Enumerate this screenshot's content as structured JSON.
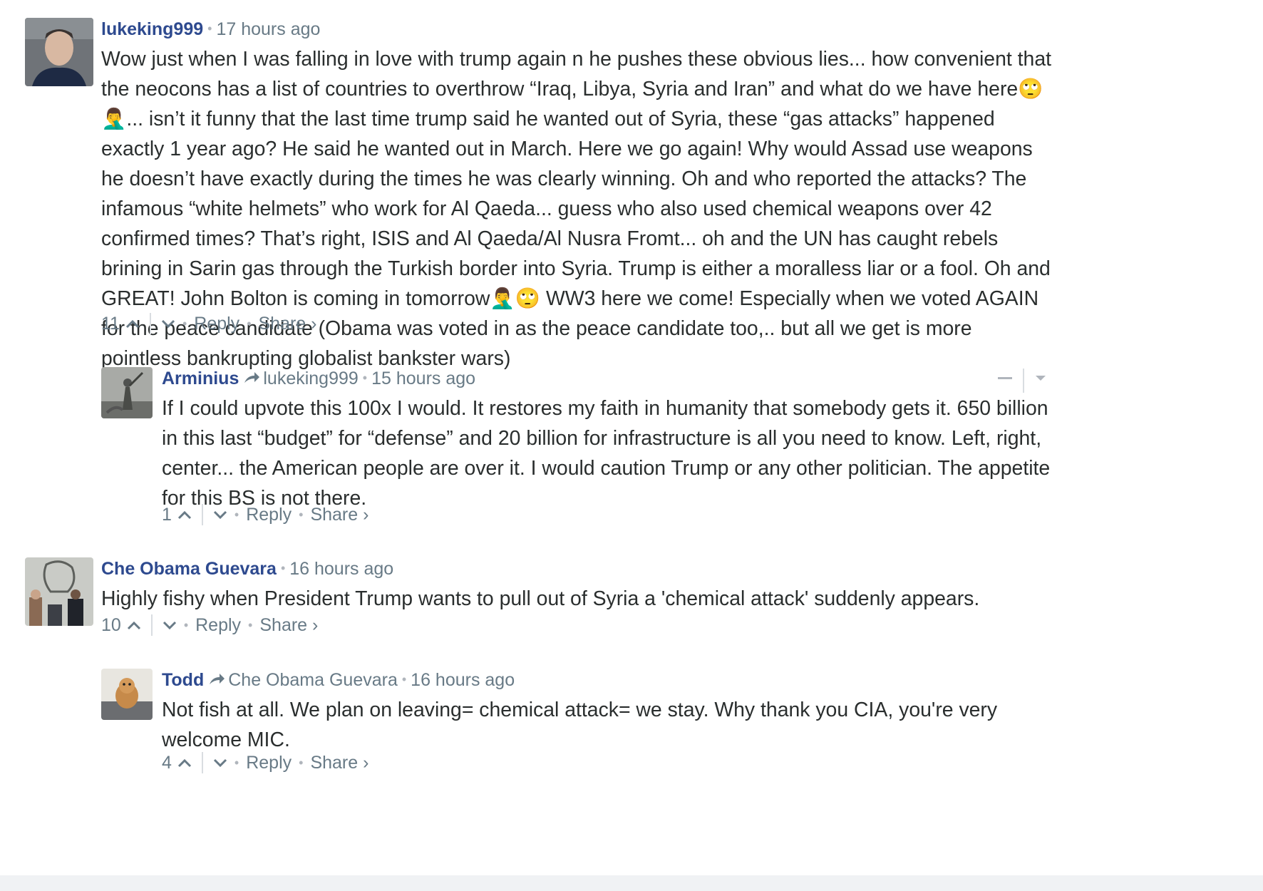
{
  "comments": [
    {
      "author": "lukeking999",
      "time": "17 hours ago",
      "body": "Wow just when I was falling in love with trump again n he pushes these obvious lies... how convenient that the neocons has a list of countries to overthrow “Iraq, Libya, Syria and Iran” and what do we have here🙄 🤦‍♂️... isn’t it funny that the last time trump said he wanted out of Syria, these “gas attacks” happened exactly 1 year ago? He said he wanted out in March. Here we go again! Why would Assad use weapons he doesn’t have exactly during the times he was clearly winning. Oh and who reported the attacks? The infamous “white helmets” who work for Al Qaeda... guess who also used chemical weapons over 42 confirmed times? That’s right, ISIS and Al Qaeda/Al Nusra Fromt... oh and the UN has caught rebels brining in Sarin gas through the Turkish border into Syria. Trump is either a moralless liar or a fool. Oh and GREAT! John Bolton is coming in tomorrow🤦‍♂️🙄  WW3 here we come! Especially when we voted AGAIN for the peace candidate (Obama was voted in as the peace candidate too,.. but all we get is more pointless bankrupting globalist bankster wars)",
      "votes": "11",
      "reply": "Reply",
      "share": "Share ›"
    },
    {
      "author": "Arminius",
      "reply_to": "lukeking999",
      "time": "15 hours ago",
      "body": "If I could upvote this 100x I would. It restores my faith in humanity that somebody gets it. 650 billion in this last “budget” for “defense” and 20 billion for infrastructure is all you need to know. Left, right, center... the American people are over it. I would caution Trump or any other politician. The appetite for this BS is not there.",
      "votes": "1",
      "reply": "Reply",
      "share": "Share ›"
    },
    {
      "author": "Che Obama Guevara",
      "time": "16 hours ago",
      "body": "Highly fishy when President Trump wants to pull out of Syria a 'chemical attack' suddenly appears.",
      "votes": "10",
      "reply": "Reply",
      "share": "Share ›"
    },
    {
      "author": "Todd",
      "reply_to": "Che Obama Guevara",
      "time": "16 hours ago",
      "body": "Not fish at all. We plan on leaving= chemical attack= we stay. Why thank you CIA, you're very welcome MIC.",
      "votes": "4",
      "reply": "Reply",
      "share": "Share ›"
    }
  ],
  "colors": {
    "author": "#2e4a8f",
    "meta": "#687a86",
    "text": "#2a2e2e",
    "divider": "#d9dde1"
  },
  "icons": [
    "reply-arrow-icon",
    "upvote-icon",
    "downvote-icon",
    "collapse-icon",
    "menu-caret-icon"
  ]
}
